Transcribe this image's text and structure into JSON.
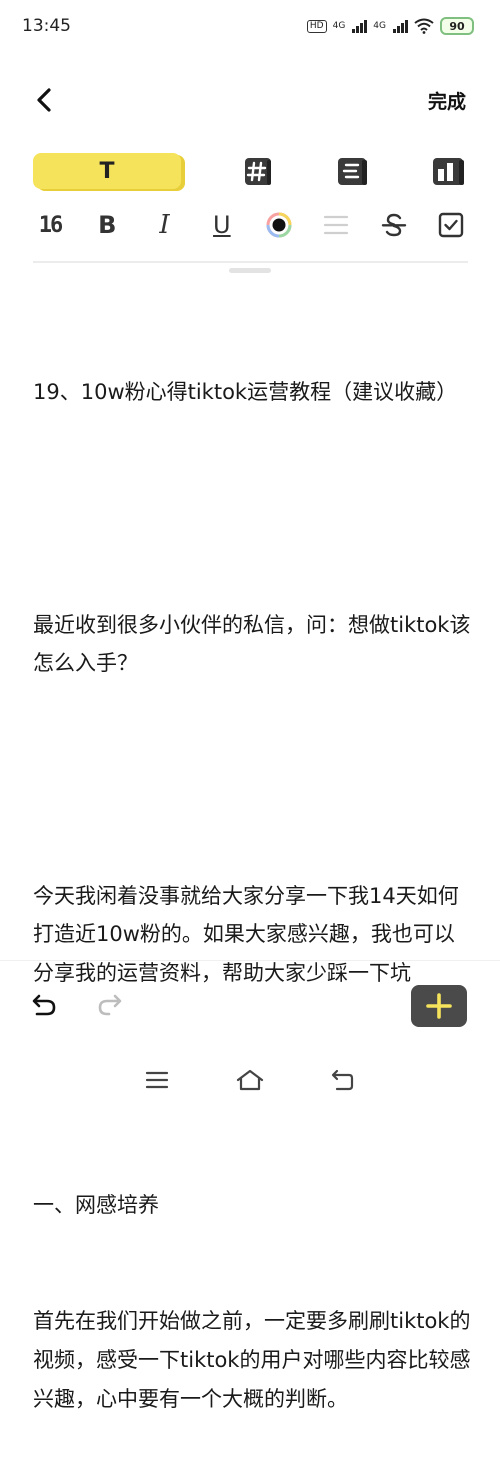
{
  "status_bar": {
    "time": "13:45",
    "hd_label": "HD",
    "sim1_label": "4G",
    "sim2_label": "4G",
    "battery": "90",
    "icons": [
      "hd-icon",
      "signal-icon",
      "signal-icon",
      "wifi-icon",
      "battery-icon"
    ]
  },
  "header": {
    "back_icon": "chevron-left-icon",
    "done_label": "完成"
  },
  "style_bar": {
    "text_style_label": "T",
    "icons": [
      "hashtag-icon",
      "list-style-icon",
      "column-layout-icon"
    ]
  },
  "format_bar": {
    "font_size": "16",
    "bold": "B",
    "italic": "I",
    "underline": "U",
    "icons": [
      "color-picker-icon",
      "align-icon",
      "strikethrough-icon",
      "checkbox-icon"
    ]
  },
  "content": {
    "paragraphs": [
      "19、10w粉心得tiktok运营教程（建议收藏）",
      "",
      "最近收到很多小伙伴的私信，问：想做tiktok该怎么入手？",
      "",
      "今天我闲着没事就给大家分享一下我14天如何打造近10w粉的。如果大家感兴趣，我也可以分享我的运营资料，帮助大家少踩一下坑",
      "",
      "一、网感培养",
      "首先在我们开始做之前，一定要多刷刷tiktok的视频，感受一下tiktok的用户对哪些内容比较感兴趣，心中要有一个大概的判断。"
    ]
  },
  "bottom_bar": {
    "icons": [
      "undo-icon",
      "redo-icon",
      "plus-icon"
    ],
    "accent_color": "#f6e35c"
  },
  "nav_bar": {
    "icons": [
      "menu-icon",
      "home-icon",
      "back-icon"
    ]
  }
}
